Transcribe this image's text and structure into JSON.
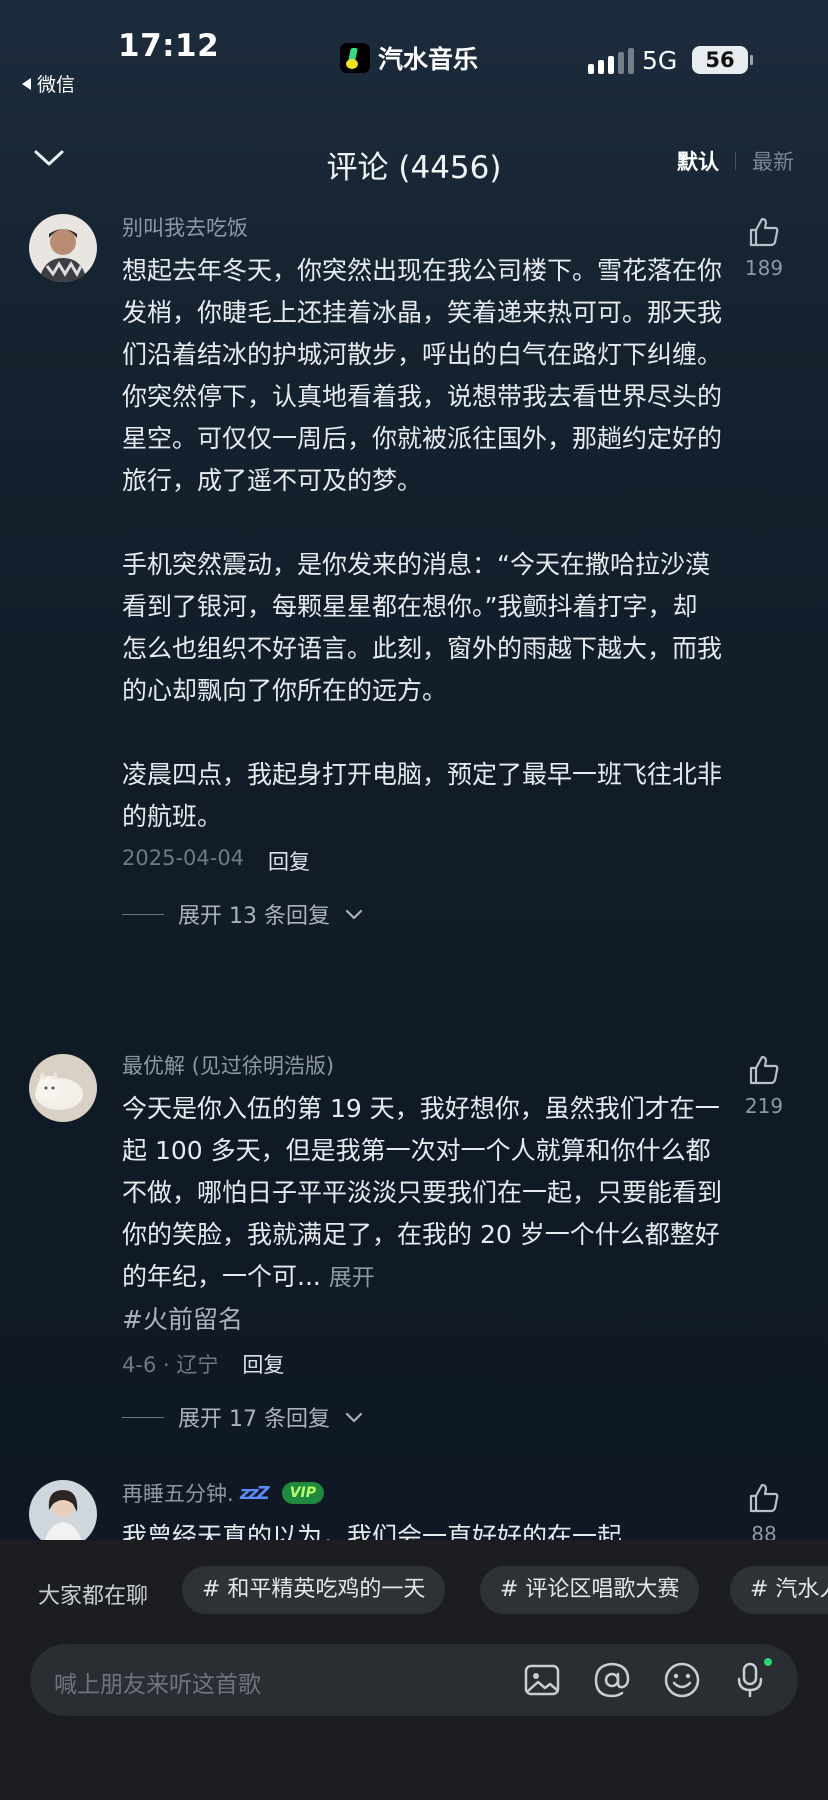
{
  "status_bar": {
    "time": "17:12",
    "back_app": "微信",
    "app_name": "汽水音乐",
    "network": "5G",
    "battery": "56"
  },
  "header": {
    "title": "评论 (4456)",
    "sort_default": "默认",
    "sort_newest": "最新"
  },
  "comments": [
    {
      "user": "别叫我去吃饭",
      "text": "想起去年冬天，你突然出现在我公司楼下。雪花落在你发梢，你睫毛上还挂着冰晶，笑着递来热可可。那天我们沿着结冰的护城河散步，呼出的白气在路灯下纠缠。你突然停下，认真地看着我，说想带我去看世界尽头的星空。可仅仅一周后，你就被派往国外，那趟约定好的旅行，成了遥不可及的梦。\n\n手机突然震动，是你发来的消息：“今天在撒哈拉沙漠看到了银河，每颗星星都在想你。”我颤抖着打字，却怎么也组织不好语言。此刻，窗外的雨越下越大，而我的心却飘向了你所在的远方。\n\n凌晨四点，我起身打开电脑，预定了最早一班飞往北非的航班。",
      "date": "2025-04-04",
      "reply_label": "回复",
      "likes": "189",
      "expand": "展开 13 条回复"
    },
    {
      "user": "最优解 (见过徐明浩版)",
      "text": "今天是你入伍的第 19 天，我好想你，虽然我们才在一起 100 多天，但是我第一次对一个人就算和你什么都不做，哪怕日子平平淡淡只要我们在一起，只要能看到你的笑脸，我就满足了，在我的 20 岁一个什么都整好的年纪，一个可...",
      "more": "展开",
      "hashtag": "#火前留名",
      "date": "4-6 · 辽宁",
      "reply_label": "回复",
      "likes": "219",
      "expand": "展开 17 条回复"
    },
    {
      "user": "再睡五分钟.",
      "user_suffix": "zzZ",
      "vip": "VIP",
      "text": "我曾经天真的以为，我们会一直好好的在一起",
      "likes": "88"
    }
  ],
  "bottom": {
    "topics_label": "大家都在聊",
    "topics": [
      "# 和平精英吃鸡的一天",
      "# 评论区唱歌大赛",
      "# 汽水人"
    ],
    "input_placeholder": "喊上朋友来听这首歌"
  }
}
